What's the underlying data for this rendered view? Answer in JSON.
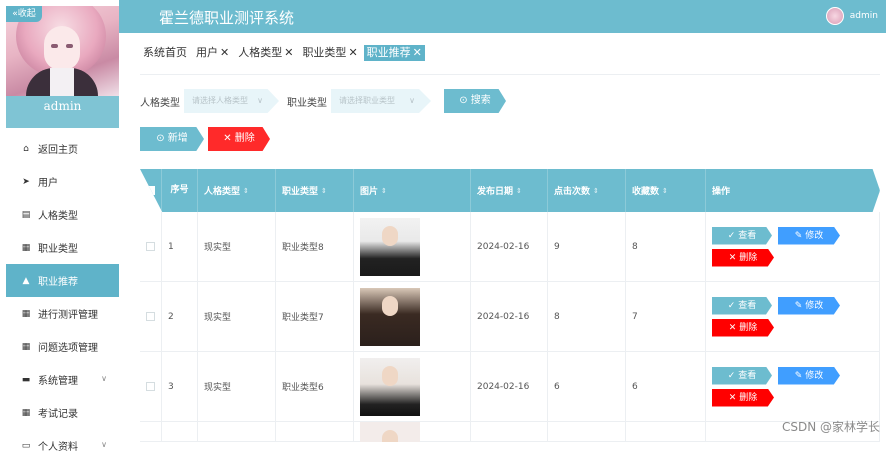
{
  "app": {
    "title": "霍兰德职业测评系统"
  },
  "sidebar": {
    "collapse_label": "«收起",
    "username": "admin",
    "items": [
      {
        "label": "返回主页",
        "icon": "home-icon",
        "glyph": "⌂",
        "active": false
      },
      {
        "label": "用户",
        "icon": "send-icon",
        "glyph": "➤",
        "active": false
      },
      {
        "label": "人格类型",
        "icon": "document-icon",
        "glyph": "▤",
        "active": false
      },
      {
        "label": "职业类型",
        "icon": "grid-icon",
        "glyph": "▦",
        "active": false
      },
      {
        "label": "职业推荐",
        "icon": "thumb-up-icon",
        "glyph": "▲",
        "active": true
      },
      {
        "label": "进行测评管理",
        "icon": "grid-icon",
        "glyph": "▦",
        "active": false
      },
      {
        "label": "问题选项管理",
        "icon": "grid-icon",
        "glyph": "▦",
        "active": false
      },
      {
        "label": "系统管理",
        "icon": "chat-icon",
        "glyph": "▬",
        "active": false,
        "has_children": true
      },
      {
        "label": "考试记录",
        "icon": "grid-icon",
        "glyph": "▦",
        "active": false
      },
      {
        "label": "个人资料",
        "icon": "user-card-icon",
        "glyph": "▭",
        "active": false,
        "has_children": true
      }
    ]
  },
  "header": {
    "username": "admin"
  },
  "tabs": [
    {
      "label": "系统首页",
      "closable": false,
      "active": false
    },
    {
      "label": "用户",
      "closable": true,
      "active": false
    },
    {
      "label": "人格类型",
      "closable": true,
      "active": false
    },
    {
      "label": "职业类型",
      "closable": true,
      "active": false
    },
    {
      "label": "职业推荐",
      "closable": true,
      "active": true
    }
  ],
  "search": {
    "personality_label": "人格类型",
    "personality_placeholder": "请选择人格类型",
    "career_label": "职业类型",
    "career_placeholder": "请选择职业类型",
    "search_button": "搜索"
  },
  "actions": {
    "add": "新增",
    "delete": "删除"
  },
  "table": {
    "columns": [
      "序号",
      "人格类型",
      "职业类型",
      "图片",
      "发布日期",
      "点击次数",
      "收藏数",
      "操作"
    ],
    "ops": {
      "view": "查看",
      "edit": "修改",
      "delete": "删除"
    },
    "rows": [
      {
        "index": "1",
        "personality": "现实型",
        "career": "职业类型8",
        "date": "2024-02-16",
        "clicks": "9",
        "favorites": "8"
      },
      {
        "index": "2",
        "personality": "现实型",
        "career": "职业类型7",
        "date": "2024-02-16",
        "clicks": "8",
        "favorites": "7"
      },
      {
        "index": "3",
        "personality": "现实型",
        "career": "职业类型6",
        "date": "2024-02-16",
        "clicks": "6",
        "favorites": "6"
      }
    ]
  },
  "watermark": "CSDN @家林学长"
}
